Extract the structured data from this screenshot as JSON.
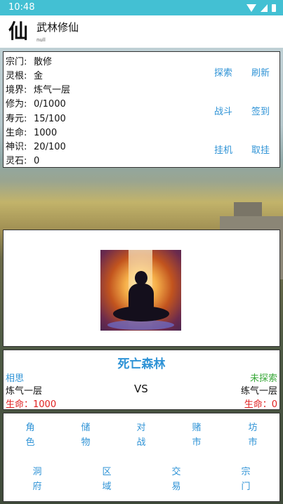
{
  "statusbar": {
    "time": "10:48"
  },
  "header": {
    "logo_char": "仙",
    "title": "武林修仙",
    "subtitle": "null"
  },
  "stats": [
    {
      "key": "宗门:",
      "value": "散修"
    },
    {
      "key": "灵根:",
      "value": "金"
    },
    {
      "key": "境界:",
      "value": "炼气一层"
    },
    {
      "key": "修为:",
      "value": "0/1000"
    },
    {
      "key": "寿元:",
      "value": "15/100"
    },
    {
      "key": "生命:",
      "value": "1000"
    },
    {
      "key": "神识:",
      "value": "20/100"
    },
    {
      "key": "灵石:",
      "value": "0"
    }
  ],
  "actions": {
    "explore": "探索",
    "refresh": "刷新",
    "battle": "战斗",
    "checkin": "签到",
    "idle": "挂机",
    "cancel_idle": "取挂"
  },
  "battle": {
    "zone": "死亡森林",
    "player_name": "相思",
    "player_realm": "炼气一层",
    "player_hp": "生命：1000",
    "vs": "VS",
    "enemy_name": "未探索",
    "enemy_realm": "练气一层",
    "enemy_hp": "生命：0"
  },
  "nav": {
    "row1": [
      "角色",
      "储物",
      "对战",
      "赌市",
      "坊市"
    ],
    "row2": [
      "洞府",
      "区域",
      "交易",
      "宗门"
    ]
  },
  "colors": {
    "status_bar": "#43c0d3",
    "link_blue": "#2f93d6",
    "hp_red": "#e02020",
    "green": "#3aa83a"
  }
}
